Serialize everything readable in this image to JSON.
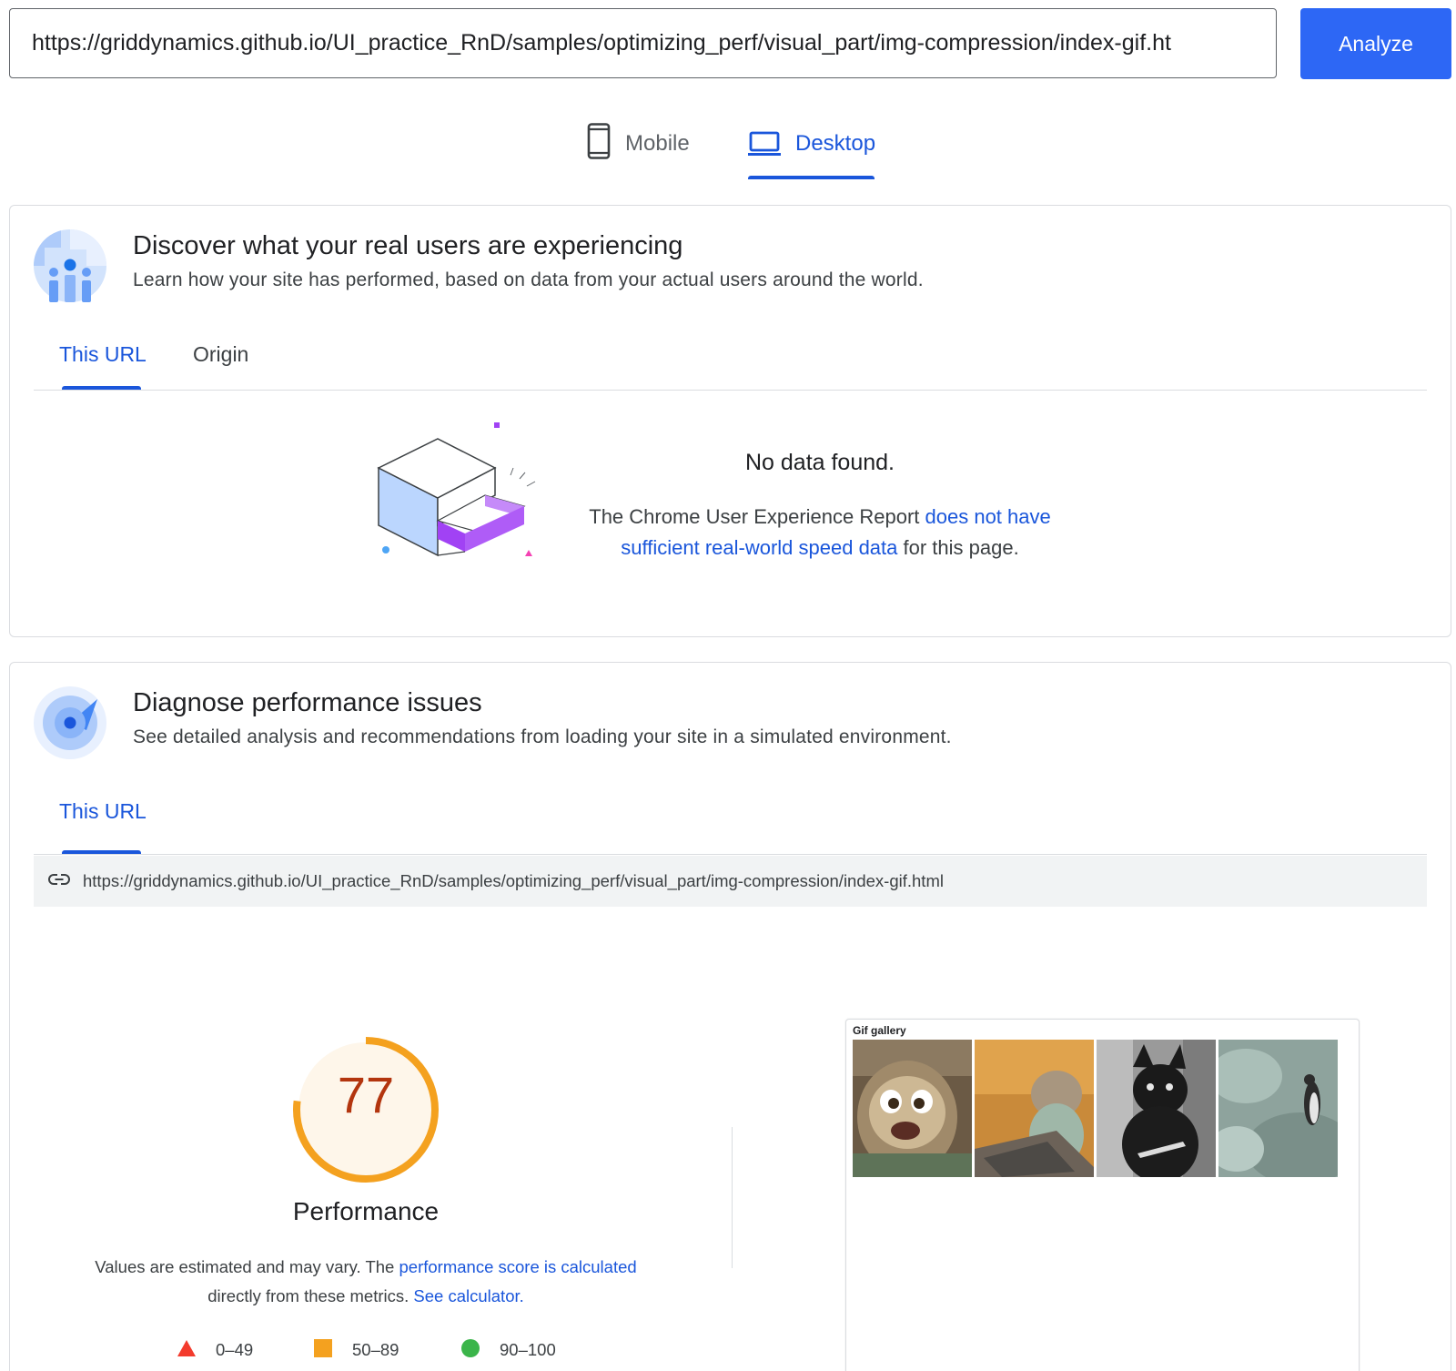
{
  "search": {
    "url_value": "https://griddynamics.github.io/UI_practice_RnD/samples/optimizing_perf/visual_part/img-compression/index-gif.ht",
    "analyze_label": "Analyze"
  },
  "device_tabs": [
    {
      "label": "Mobile",
      "icon": "phone-icon",
      "selected": false
    },
    {
      "label": "Desktop",
      "icon": "laptop-icon",
      "selected": true
    }
  ],
  "field_card": {
    "title": "Discover what your real users are experiencing",
    "subtitle": "Learn how your site has performed, based on data from your actual users around the world.",
    "tabs": [
      {
        "label": "This URL",
        "selected": true
      },
      {
        "label": "Origin",
        "selected": false
      }
    ],
    "no_data": {
      "title": "No data found.",
      "text_before": "The Chrome User Experience Report ",
      "link": "does not have sufficient real-world speed data",
      "text_after": " for this page."
    }
  },
  "lab_card": {
    "title": "Diagnose performance issues",
    "subtitle": "See detailed analysis and recommendations from loading your site in a simulated environment.",
    "tabs": [
      {
        "label": "This URL",
        "selected": true
      }
    ],
    "tested_url": "https://griddynamics.github.io/UI_practice_RnD/samples/optimizing_perf/visual_part/img-compression/index-gif.html",
    "score": {
      "value": "77",
      "fraction": 0.77,
      "label": "Performance",
      "color": "#f4a11f",
      "text_color": "#b3350e"
    },
    "description": {
      "text1": "Values are estimated and may vary. The ",
      "link1": "performance score is calculated",
      "text2": "directly from these metrics. ",
      "link2": "See calculator."
    },
    "legend": [
      {
        "range": "0–49",
        "shape": "triangle",
        "color": "#f33b2d"
      },
      {
        "range": "50–89",
        "shape": "square",
        "color": "#f4a11f"
      },
      {
        "range": "90–100",
        "shape": "circle",
        "color": "#3bb54a"
      }
    ],
    "preview": {
      "title": "Gif gallery"
    }
  }
}
